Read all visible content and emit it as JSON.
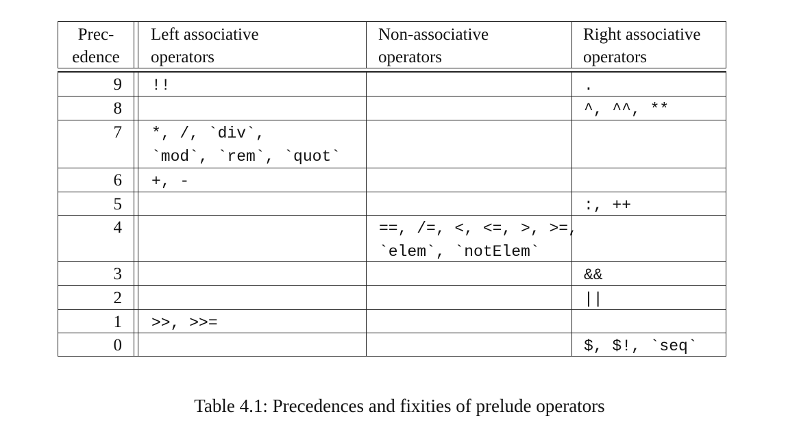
{
  "table": {
    "headers": {
      "precedence": [
        "Prec-",
        "edence"
      ],
      "left": [
        "Left associative",
        "operators"
      ],
      "non": [
        "Non-associative",
        "operators"
      ],
      "right": [
        "Right associative",
        "operators"
      ]
    },
    "rows": [
      {
        "prec": "9",
        "left": "!!",
        "non": "",
        "right": "."
      },
      {
        "prec": "8",
        "left": "",
        "non": "",
        "right": "^, ^^, **"
      },
      {
        "prec": "7",
        "left": "*, /, `div`,\n`mod`, `rem`, `quot`",
        "non": "",
        "right": ""
      },
      {
        "prec": "6",
        "left": "+, -",
        "non": "",
        "right": ""
      },
      {
        "prec": "5",
        "left": "",
        "non": "",
        "right": ":, ++"
      },
      {
        "prec": "4",
        "left": "",
        "non": "==, /=, <, <=, >, >=,\n`elem`, `notElem`",
        "right": ""
      },
      {
        "prec": "3",
        "left": "",
        "non": "",
        "right": "&&"
      },
      {
        "prec": "2",
        "left": "",
        "non": "",
        "right": "||"
      },
      {
        "prec": "1",
        "left": ">>, >>=",
        "non": "",
        "right": ""
      },
      {
        "prec": "0",
        "left": "",
        "non": "",
        "right": "$, $!, `seq`"
      }
    ]
  },
  "caption": "Table 4.1: Precedences and fixities of prelude operators"
}
